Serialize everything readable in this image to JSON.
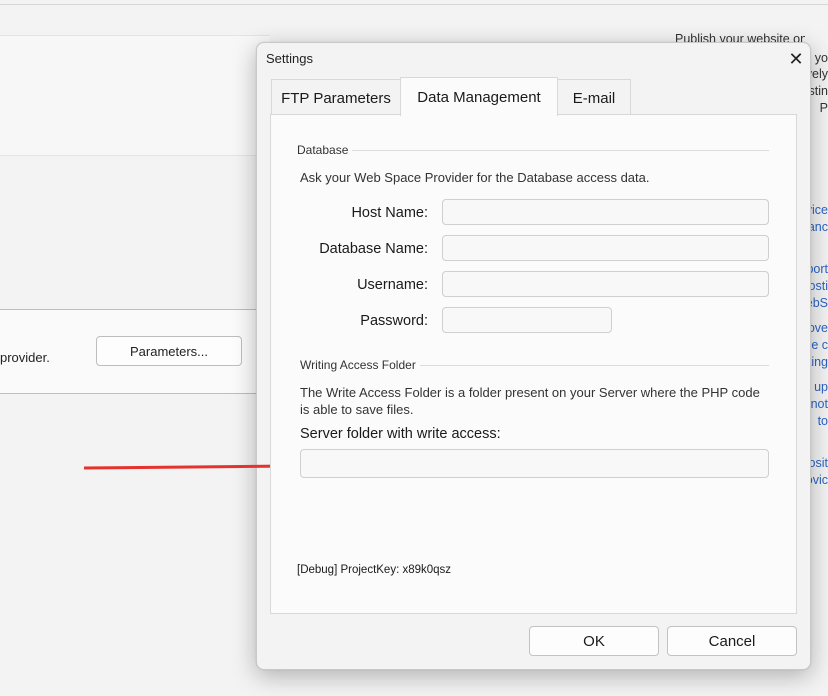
{
  "background": {
    "top_right_text": "Publish your website onto",
    "provider_text": "provider.",
    "parameters_button": "Parameters...",
    "right_strip": [
      "n yo",
      "vely",
      "stin",
      "P",
      "vice",
      "anc",
      "port",
      "osti",
      "ebS",
      "ove",
      "ce c",
      "ting",
      "up",
      "not",
      "to",
      "osit",
      "ovic"
    ]
  },
  "dialog": {
    "title": "Settings",
    "close_symbol": "✕",
    "tabs": [
      {
        "label": "FTP Parameters",
        "active": false
      },
      {
        "label": "Data Management",
        "active": true
      },
      {
        "label": "E-mail",
        "active": false
      }
    ],
    "database": {
      "legend": "Database",
      "hint": "Ask your Web Space Provider for the Database access data.",
      "fields": [
        {
          "label": "Host Name:",
          "value": ""
        },
        {
          "label": "Database Name:",
          "value": ""
        },
        {
          "label": "Username:",
          "value": ""
        },
        {
          "label": "Password:",
          "value": ""
        }
      ]
    },
    "writing_access": {
      "legend": "Writing Access Folder",
      "hint": "The Write Access Folder is a folder present on your Server where the PHP code is able to save files.",
      "server_folder_label": "Server folder with write access:",
      "server_folder_value": ""
    },
    "debug_text": "[Debug] ProjectKey: x89k0qsz",
    "ok_label": "OK",
    "cancel_label": "Cancel"
  },
  "colors": {
    "accent_yellow": "#f1c21b",
    "arrow_red": "#e5322d",
    "link_blue": "#2a64c5"
  }
}
